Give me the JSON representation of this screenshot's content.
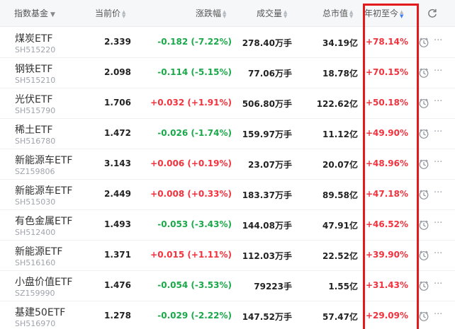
{
  "header": {
    "col_name": "指数基金",
    "col_price": "当前价",
    "col_change": "涨跌幅",
    "col_volume": "成交量",
    "col_market_cap": "总市值",
    "col_ytd": "年初至今"
  },
  "icons": [
    "refresh-icon",
    "clock-icon",
    "more-icon",
    "sort-icon",
    "chevron-down-icon"
  ],
  "colors": {
    "up": "#f2323c",
    "down": "#1ba84a",
    "highlight": "#e41a1a",
    "sort_active": "#3b7cf6"
  },
  "rows": [
    {
      "name": "煤炭ETF",
      "code": "SH515220",
      "price": "2.339",
      "change": "-0.182 (-7.22%)",
      "direction": "down",
      "volume": "278.40万手",
      "market_cap": "34.19亿",
      "ytd": "+78.14%"
    },
    {
      "name": "钢铁ETF",
      "code": "SH515210",
      "price": "2.098",
      "change": "-0.114 (-5.15%)",
      "direction": "down",
      "volume": "77.06万手",
      "market_cap": "18.78亿",
      "ytd": "+70.15%"
    },
    {
      "name": "光伏ETF",
      "code": "SH515790",
      "price": "1.706",
      "change": "+0.032 (+1.91%)",
      "direction": "up",
      "volume": "506.80万手",
      "market_cap": "122.62亿",
      "ytd": "+50.18%"
    },
    {
      "name": "稀土ETF",
      "code": "SH516780",
      "price": "1.472",
      "change": "-0.026 (-1.74%)",
      "direction": "down",
      "volume": "159.97万手",
      "market_cap": "11.12亿",
      "ytd": "+49.90%"
    },
    {
      "name": "新能源车ETF",
      "code": "SZ159806",
      "price": "3.143",
      "change": "+0.006 (+0.19%)",
      "direction": "up",
      "volume": "23.07万手",
      "market_cap": "20.07亿",
      "ytd": "+48.96%"
    },
    {
      "name": "新能源车ETF",
      "code": "SH515030",
      "price": "2.449",
      "change": "+0.008 (+0.33%)",
      "direction": "up",
      "volume": "183.37万手",
      "market_cap": "89.58亿",
      "ytd": "+47.18%"
    },
    {
      "name": "有色金属ETF",
      "code": "SH512400",
      "price": "1.493",
      "change": "-0.053 (-3.43%)",
      "direction": "down",
      "volume": "144.08万手",
      "market_cap": "47.91亿",
      "ytd": "+46.52%"
    },
    {
      "name": "新能源ETF",
      "code": "SH516160",
      "price": "1.371",
      "change": "+0.015 (+1.11%)",
      "direction": "up",
      "volume": "112.03万手",
      "market_cap": "22.52亿",
      "ytd": "+39.90%"
    },
    {
      "name": "小盘价值ETF",
      "code": "SZ159990",
      "price": "1.476",
      "change": "-0.054 (-3.53%)",
      "direction": "down",
      "volume": "79223手",
      "market_cap": "1.55亿",
      "ytd": "+31.43%"
    },
    {
      "name": "基建50ETF",
      "code": "SH516970",
      "price": "1.278",
      "change": "-0.029 (-2.22%)",
      "direction": "down",
      "volume": "147.52万手",
      "market_cap": "57.47亿",
      "ytd": "+29.09%"
    }
  ]
}
